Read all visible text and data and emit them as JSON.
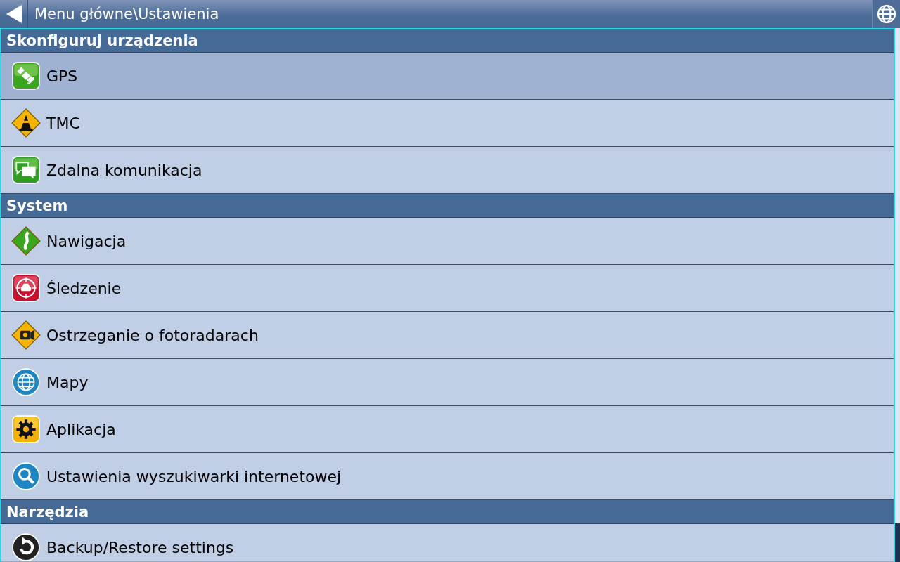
{
  "window": {
    "title": "Menu główne\\Ustawienia"
  },
  "sections": [
    {
      "title": "Skonfiguruj urządzenia",
      "items": [
        {
          "label": "GPS",
          "selected": true
        },
        {
          "label": "TMC",
          "selected": false
        },
        {
          "label": "Zdalna komunikacja",
          "selected": false
        }
      ]
    },
    {
      "title": "System",
      "items": [
        {
          "label": "Nawigacja",
          "selected": false
        },
        {
          "label": "Śledzenie",
          "selected": false
        },
        {
          "label": "Ostrzeganie o fotoradarach",
          "selected": false
        },
        {
          "label": "Mapy",
          "selected": false
        },
        {
          "label": "Aplikacja",
          "selected": false
        },
        {
          "label": "Ustawienia wyszukiwarki internetowej",
          "selected": false
        }
      ]
    },
    {
      "title": "Narzędzia",
      "items": [
        {
          "label": "Backup/Restore settings",
          "selected": false
        }
      ]
    }
  ]
}
